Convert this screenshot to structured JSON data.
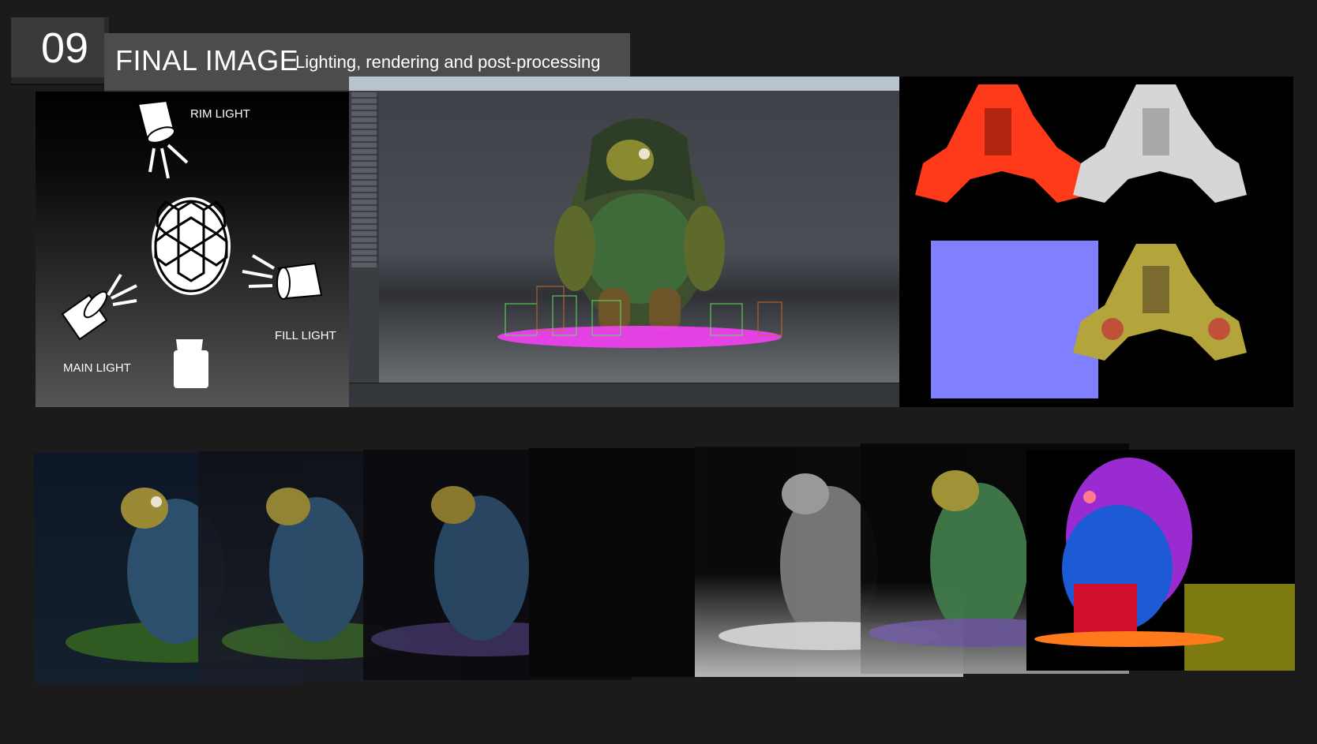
{
  "header": {
    "number": "09",
    "title": "FINAL IMAGE",
    "subtitle": "Lighting, rendering and post-processing"
  },
  "lighting_diagram": {
    "rim_light": "RIM LIGHT",
    "fill_light": "FILL LIGHT",
    "main_light": "MAIN LIGHT"
  },
  "texture_maps": [
    "color-map-red",
    "displacement-map-grey",
    "normal-map-blue",
    "diffuse-map-color"
  ],
  "render_passes": [
    "final-render",
    "beauty",
    "diffuse",
    "shadow",
    "occlusion",
    "color",
    "object-id"
  ],
  "colors": {
    "background": "#1b1b1b",
    "header_bar": "#4c4c4c",
    "normal_map": "#8080ff",
    "selection_magenta": "#ff40ff"
  }
}
